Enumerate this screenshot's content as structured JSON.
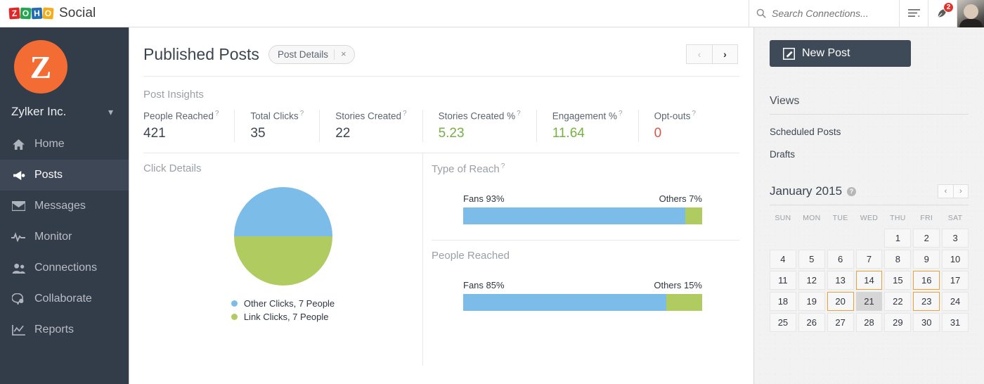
{
  "topbar": {
    "brand_name": "Social",
    "logo_letters": [
      "Z",
      "O",
      "H",
      "O"
    ],
    "search_placeholder": "Search Connections...",
    "search_value": "",
    "notification_count": "2"
  },
  "sidebar": {
    "org_initial": "Z",
    "org_name": "Zylker Inc.",
    "items": [
      {
        "label": "Home",
        "icon": "home-icon",
        "active": false
      },
      {
        "label": "Posts",
        "icon": "megaphone-icon",
        "active": true
      },
      {
        "label": "Messages",
        "icon": "envelope-icon",
        "active": false
      },
      {
        "label": "Monitor",
        "icon": "pulse-icon",
        "active": false
      },
      {
        "label": "Connections",
        "icon": "people-icon",
        "active": false
      },
      {
        "label": "Collaborate",
        "icon": "chat-icon",
        "active": false
      },
      {
        "label": "Reports",
        "icon": "chart-icon",
        "active": false
      }
    ]
  },
  "main": {
    "page_title": "Published Posts",
    "tag_label": "Post Details",
    "tag_close": "×",
    "prev_label": "‹",
    "next_label": "›",
    "insights_title": "Post Insights",
    "metrics": [
      {
        "label": "People Reached",
        "value": "421",
        "color": "default"
      },
      {
        "label": "Total Clicks",
        "value": "35",
        "color": "default"
      },
      {
        "label": "Stories Created",
        "value": "22",
        "color": "default"
      },
      {
        "label": "Stories Created %",
        "value": "5.23",
        "color": "green"
      },
      {
        "label": "Engagement %",
        "value": "11.64",
        "color": "green"
      },
      {
        "label": "Opt-outs",
        "value": "0",
        "color": "red"
      }
    ],
    "help_marker": "?",
    "click_details_title": "Click Details",
    "type_of_reach_title": "Type of Reach",
    "people_reached_title": "People Reached"
  },
  "chart_data": [
    {
      "type": "pie",
      "title": "Click Details",
      "labels": [
        "Other Clicks, 7 People",
        "Link Clicks, 7 People"
      ],
      "values": [
        50,
        50
      ],
      "colors": [
        "#7cbce8",
        "#b0cc60"
      ],
      "legend": "bottom"
    },
    {
      "type": "bar",
      "title": "Type of Reach",
      "orientation": "horizontal-stacked",
      "categories": [
        "Fans",
        "Others"
      ],
      "values": [
        93,
        7
      ],
      "labels": [
        "Fans 93%",
        "Others 7%"
      ],
      "colors": [
        "#7cbce8",
        "#b0cc60"
      ],
      "unit": "%"
    },
    {
      "type": "bar",
      "title": "People Reached",
      "orientation": "horizontal-stacked",
      "categories": [
        "Fans",
        "Others"
      ],
      "values": [
        85,
        15
      ],
      "labels": [
        "Fans 85%",
        "Others 15%"
      ],
      "colors": [
        "#7cbce8",
        "#b0cc60"
      ],
      "unit": "%"
    }
  ],
  "rightpanel": {
    "new_post_label": "New Post",
    "views_title": "Views",
    "views": [
      {
        "label": "Scheduled Posts"
      },
      {
        "label": "Drafts"
      }
    ],
    "calendar": {
      "title": "January 2015",
      "help_marker": "?",
      "prev_label": "‹",
      "next_label": "›",
      "dow": [
        "SUN",
        "MON",
        "TUE",
        "WED",
        "THU",
        "FRI",
        "SAT"
      ],
      "lead_blanks": 4,
      "days": [
        1,
        2,
        3,
        4,
        5,
        6,
        7,
        8,
        9,
        10,
        11,
        12,
        13,
        14,
        15,
        16,
        17,
        18,
        19,
        20,
        21,
        22,
        23,
        24,
        25,
        26,
        27,
        28,
        29,
        30,
        31
      ],
      "marked_days": [
        14,
        16,
        20,
        23
      ],
      "selected_day": 21
    }
  },
  "colors": {
    "accent_blue": "#7cbce8",
    "accent_green": "#b0cc60",
    "brand_orange": "#f26c33",
    "sidebar_bg": "#333c49",
    "marked_border": "#e8a33d",
    "value_green": "#76b043",
    "value_red": "#d9534f",
    "badge_red": "#e0322b"
  }
}
